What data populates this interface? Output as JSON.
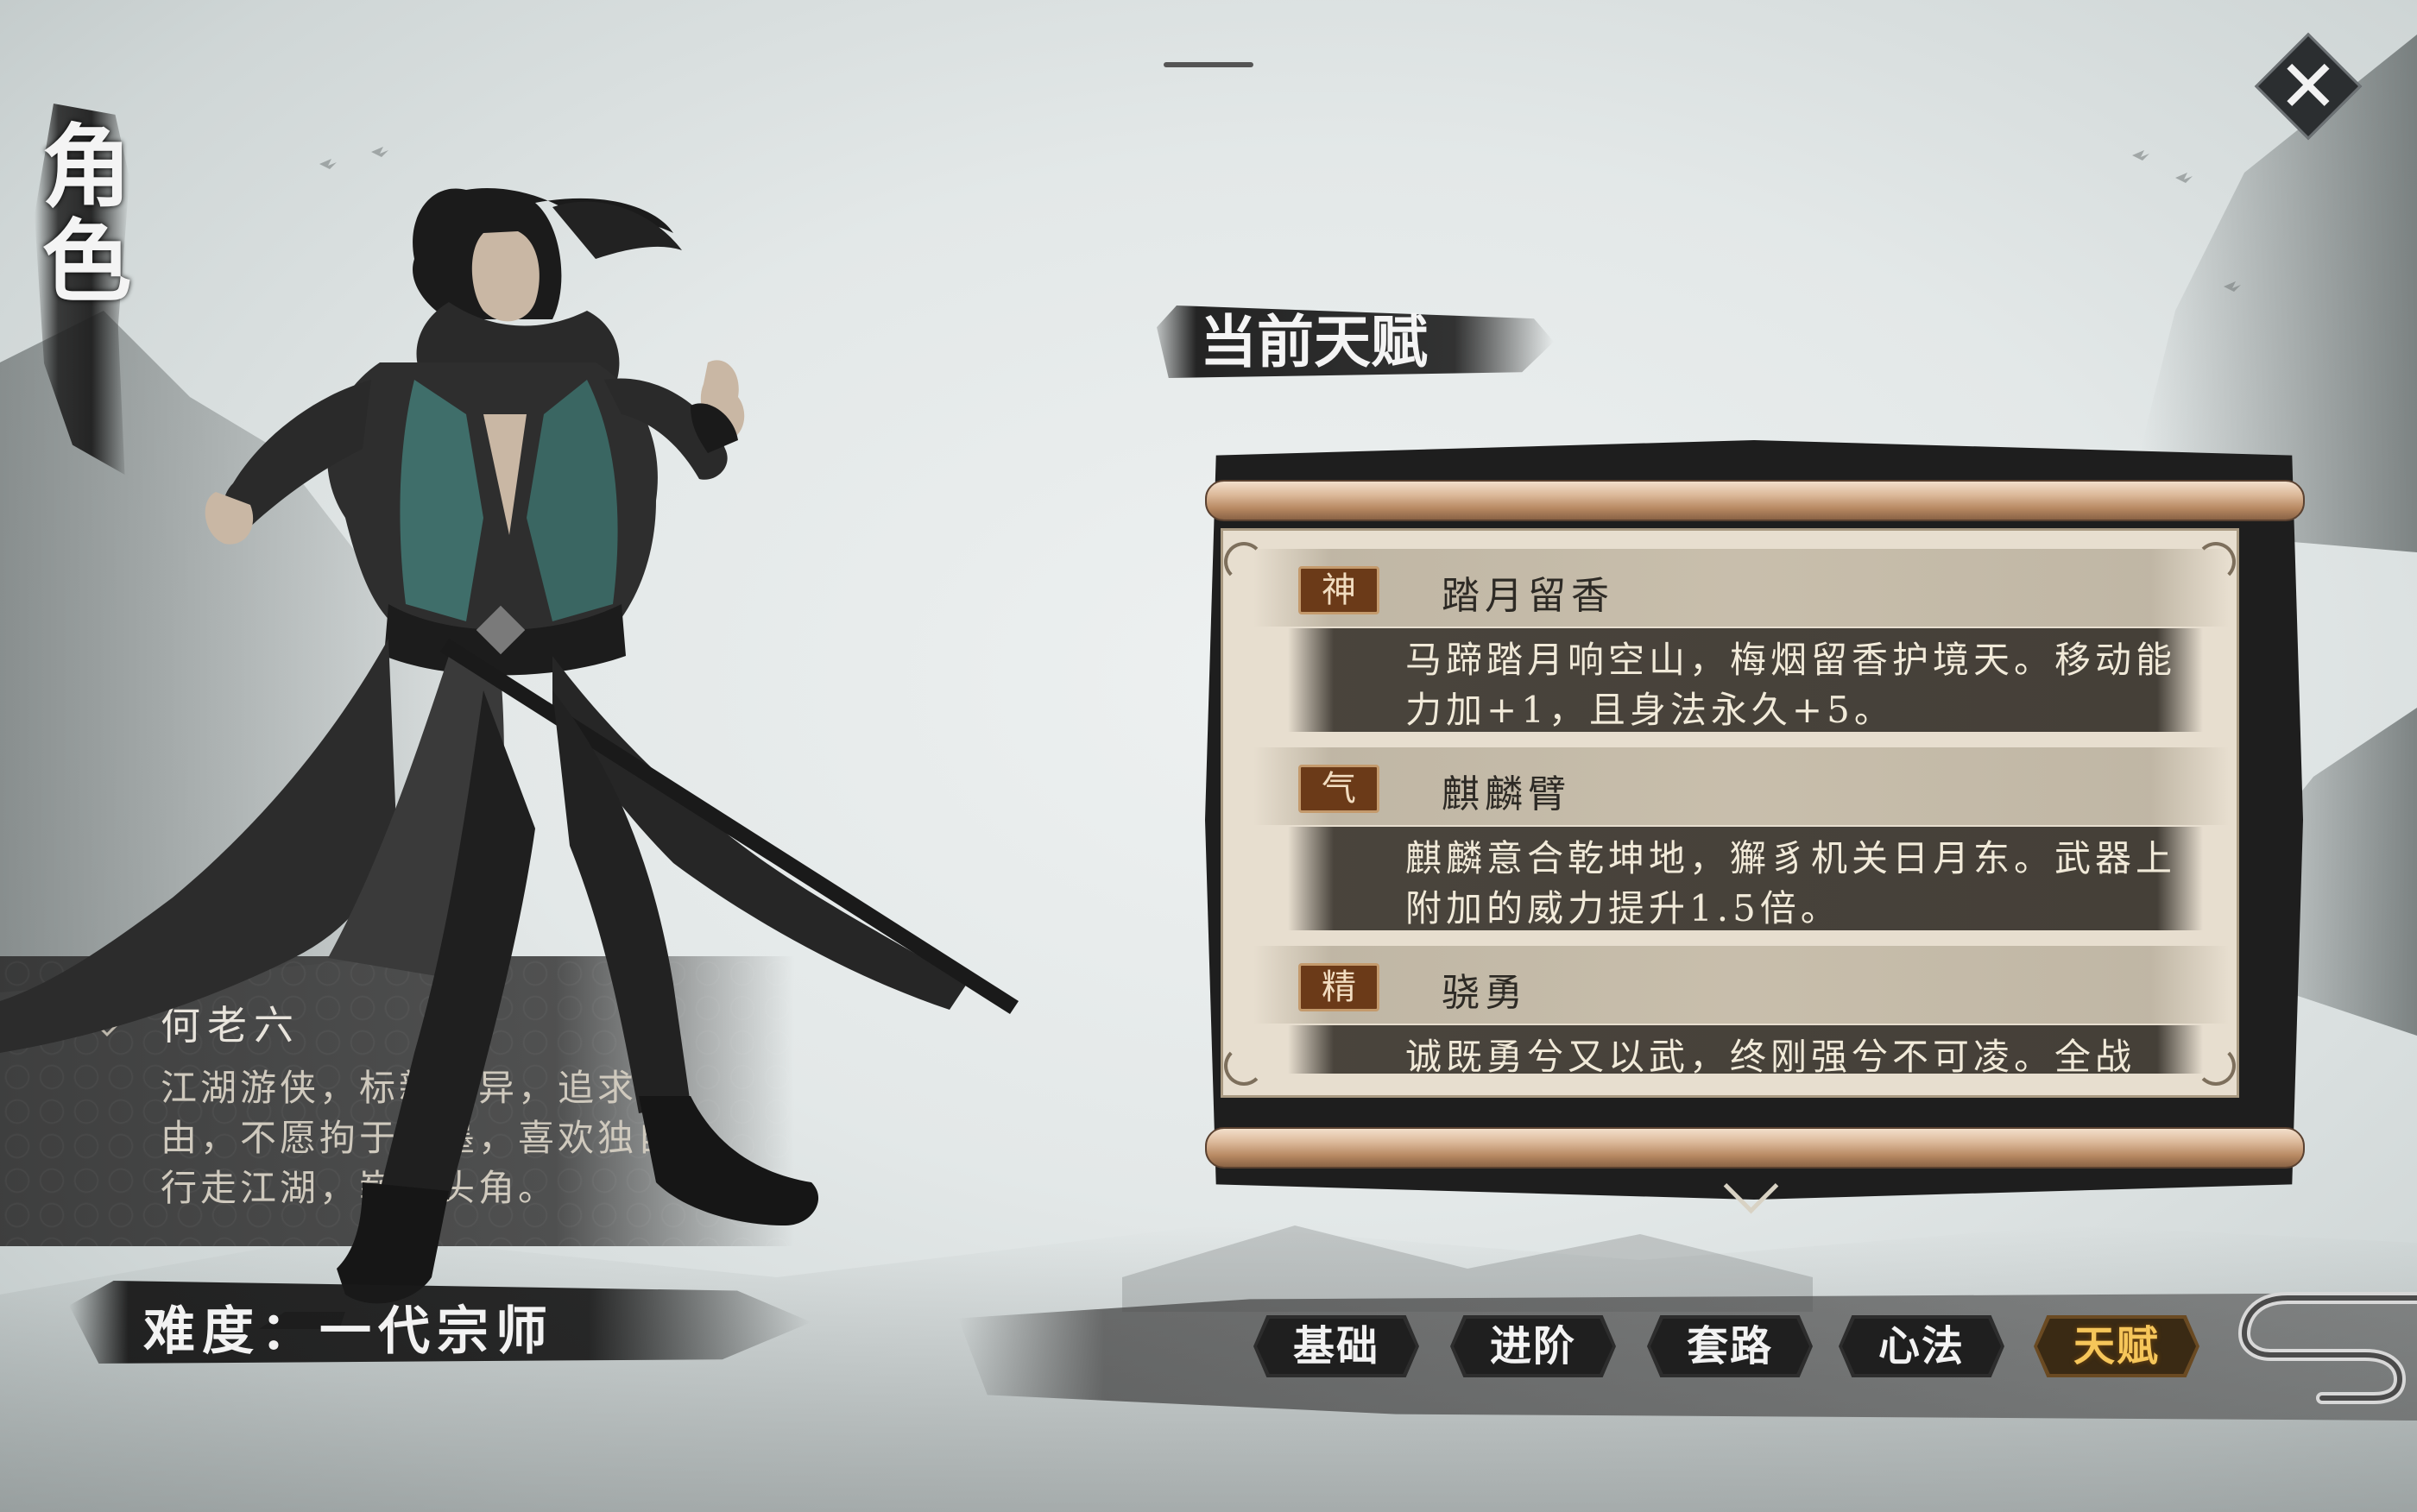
{
  "header": {
    "vertical_title": "角色",
    "close_icon": "close-x-icon",
    "drag_handle": "drag-handle"
  },
  "character": {
    "name": "何老六",
    "description": "江湖游侠，标新立异，追求自由，不愿拘于绳墨，喜欢独自行走江湖，崭露头角。",
    "difficulty": "难度：一代宗师"
  },
  "talent_panel": {
    "title": "当前天赋",
    "talents": [
      {
        "tag": "神",
        "name": "踏月留香",
        "description": "马蹄踏月响空山，梅烟留香护境天。移动能力加+1，且身法永久+5。"
      },
      {
        "tag": "气",
        "name": "麒麟臂",
        "description": "麒麟意合乾坤地，獬豸机关日月东。武器上附加的威力提升1.5倍。"
      },
      {
        "tag": "精",
        "name": "骁勇",
        "description": "诚既勇兮又以武，终刚强兮不可凌。全战"
      }
    ],
    "scroll_more_icon": "chevron-down-icon"
  },
  "tabs": {
    "items": [
      {
        "label": "基础",
        "active": false
      },
      {
        "label": "进阶",
        "active": false
      },
      {
        "label": "套路",
        "active": false
      },
      {
        "label": "心法",
        "active": false
      },
      {
        "label": "天赋",
        "active": true
      }
    ]
  },
  "colors": {
    "active_tab_text": "#f6c65a",
    "tag_background": "#6b3a18",
    "scroll_roller": "#dcb99a",
    "panel_dark": "#3c3730"
  }
}
